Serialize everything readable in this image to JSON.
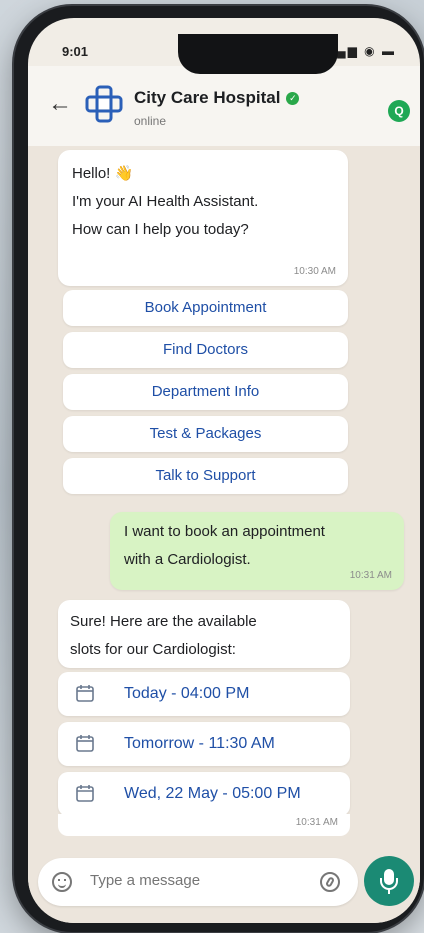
{
  "status_bar": {
    "time": "9:01",
    "icons": "▂▄▆ ◉ ▬"
  },
  "header": {
    "back_icon": "arrow-left-icon",
    "title": "City Care Hospital",
    "verified": "✓",
    "status": "online",
    "badge": "Q"
  },
  "greeting": {
    "line1": "Hello! 👋",
    "line2": "I'm your AI Health Assistant.",
    "line3": "How can I help you today?",
    "time": "10:30 AM"
  },
  "options": [
    {
      "label": "Book Appointment"
    },
    {
      "label": "Find Doctors"
    },
    {
      "label": "Department Info"
    },
    {
      "label": "Test & Packages"
    },
    {
      "label": "Talk to Support"
    }
  ],
  "user_message": {
    "line1": "I want to book an appointment",
    "line2": "with a Cardiologist.",
    "time": "10:31 AM"
  },
  "reply": {
    "line1": "Sure! Here are the available",
    "line2": "slots for our Cardiologist:"
  },
  "slots": [
    {
      "label": "Today - 04:00 PM"
    },
    {
      "label": "Tomorrow - 11:30 AM"
    },
    {
      "label": "Wed, 22 May - 05:00 PM"
    }
  ],
  "slots_time": "10:31 AM",
  "composer": {
    "placeholder": "Type a message"
  },
  "colors": {
    "accent_blue": "#1f4fa6",
    "user_bubble": "#d8f3c4",
    "mic_green": "#1b8a74",
    "logo_blue": "#2a5fb8"
  }
}
